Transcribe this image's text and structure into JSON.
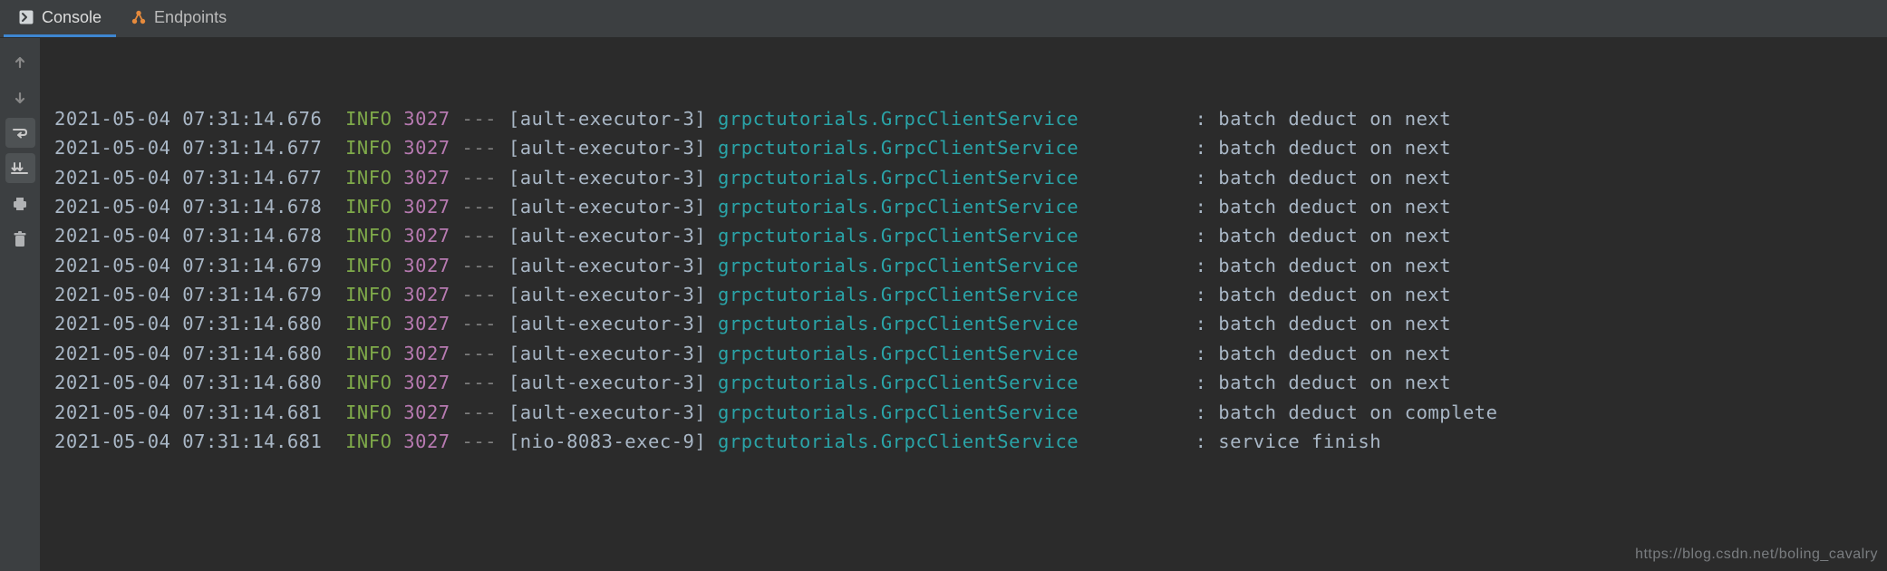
{
  "tabs": {
    "console": "Console",
    "endpoints": "Endpoints"
  },
  "log": {
    "levelPad": 5,
    "threadPad": 16,
    "loggerPad": 40,
    "rows": [
      {
        "ts": "2021-05-04 07:31:14.676",
        "level": "INFO",
        "pid": "3027",
        "thread": "ault-executor-3",
        "logger": "grpctutorials.GrpcClientService",
        "msg": "batch deduct on next"
      },
      {
        "ts": "2021-05-04 07:31:14.677",
        "level": "INFO",
        "pid": "3027",
        "thread": "ault-executor-3",
        "logger": "grpctutorials.GrpcClientService",
        "msg": "batch deduct on next"
      },
      {
        "ts": "2021-05-04 07:31:14.677",
        "level": "INFO",
        "pid": "3027",
        "thread": "ault-executor-3",
        "logger": "grpctutorials.GrpcClientService",
        "msg": "batch deduct on next"
      },
      {
        "ts": "2021-05-04 07:31:14.678",
        "level": "INFO",
        "pid": "3027",
        "thread": "ault-executor-3",
        "logger": "grpctutorials.GrpcClientService",
        "msg": "batch deduct on next"
      },
      {
        "ts": "2021-05-04 07:31:14.678",
        "level": "INFO",
        "pid": "3027",
        "thread": "ault-executor-3",
        "logger": "grpctutorials.GrpcClientService",
        "msg": "batch deduct on next"
      },
      {
        "ts": "2021-05-04 07:31:14.679",
        "level": "INFO",
        "pid": "3027",
        "thread": "ault-executor-3",
        "logger": "grpctutorials.GrpcClientService",
        "msg": "batch deduct on next"
      },
      {
        "ts": "2021-05-04 07:31:14.679",
        "level": "INFO",
        "pid": "3027",
        "thread": "ault-executor-3",
        "logger": "grpctutorials.GrpcClientService",
        "msg": "batch deduct on next"
      },
      {
        "ts": "2021-05-04 07:31:14.680",
        "level": "INFO",
        "pid": "3027",
        "thread": "ault-executor-3",
        "logger": "grpctutorials.GrpcClientService",
        "msg": "batch deduct on next"
      },
      {
        "ts": "2021-05-04 07:31:14.680",
        "level": "INFO",
        "pid": "3027",
        "thread": "ault-executor-3",
        "logger": "grpctutorials.GrpcClientService",
        "msg": "batch deduct on next"
      },
      {
        "ts": "2021-05-04 07:31:14.680",
        "level": "INFO",
        "pid": "3027",
        "thread": "ault-executor-3",
        "logger": "grpctutorials.GrpcClientService",
        "msg": "batch deduct on next"
      },
      {
        "ts": "2021-05-04 07:31:14.681",
        "level": "INFO",
        "pid": "3027",
        "thread": "ault-executor-3",
        "logger": "grpctutorials.GrpcClientService",
        "msg": "batch deduct on complete"
      },
      {
        "ts": "2021-05-04 07:31:14.681",
        "level": "INFO",
        "pid": "3027",
        "thread": "nio-8083-exec-9",
        "logger": "grpctutorials.GrpcClientService",
        "msg": "service finish"
      }
    ]
  },
  "watermark": "https://blog.csdn.net/boling_cavalry"
}
